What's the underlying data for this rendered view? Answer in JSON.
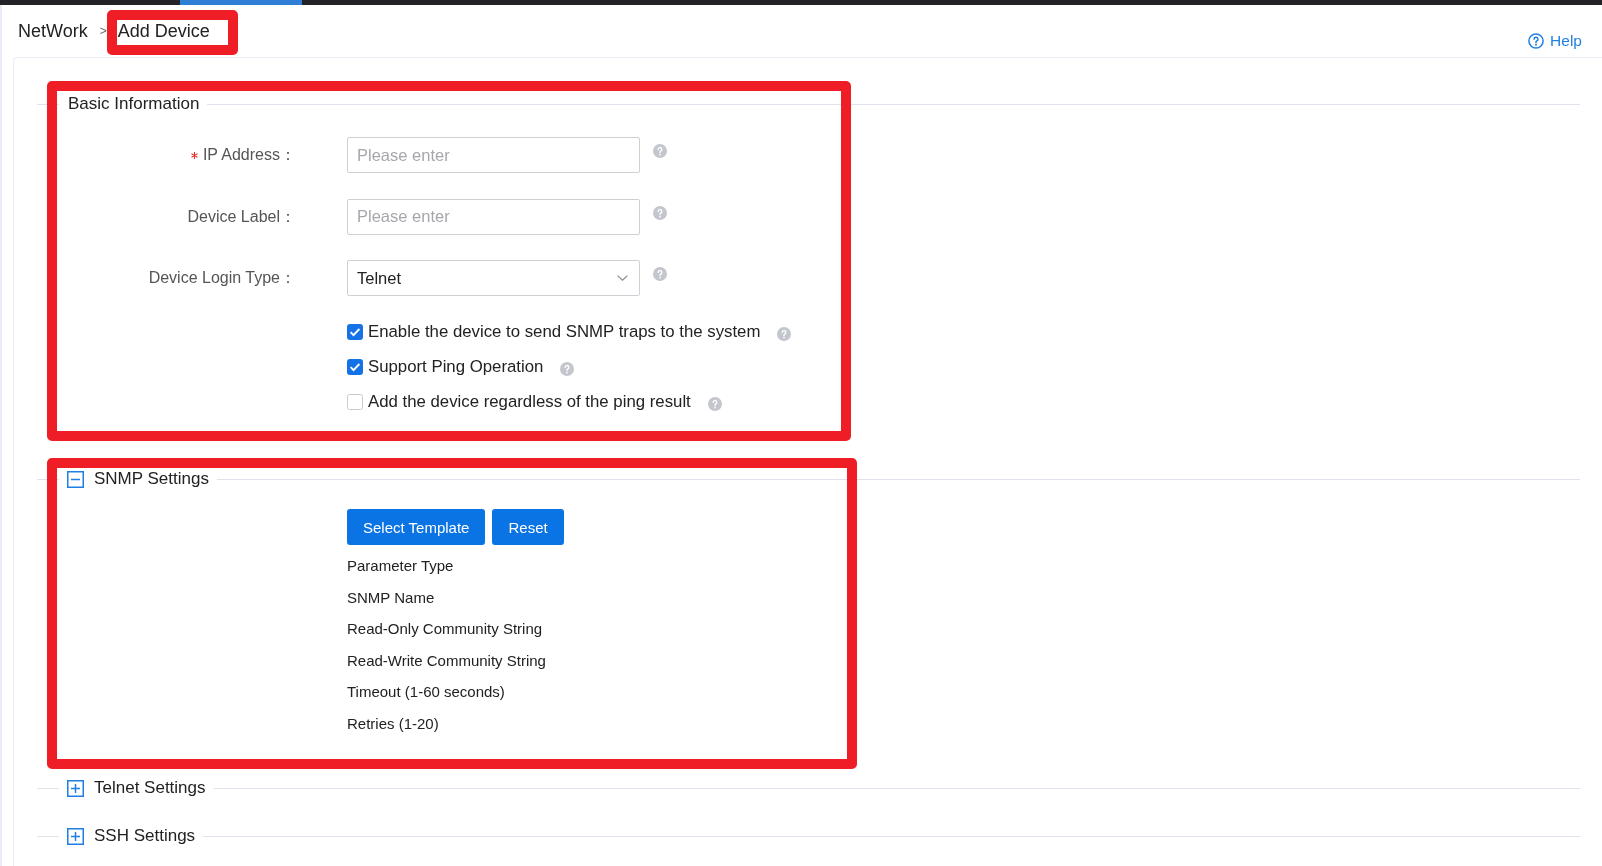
{
  "breadcrumb": {
    "separator": ">",
    "items": [
      {
        "label": "NetWork",
        "highlighted": false
      },
      {
        "label": "Add Device",
        "highlighted": true
      }
    ]
  },
  "help_link": {
    "label": "Help"
  },
  "sections": [
    {
      "kind": "fieldset",
      "title": "Basic Information",
      "highlighted": true,
      "fields": [
        {
          "kind": "text",
          "label": "IP Address：",
          "required": true,
          "placeholder": "Please enter"
        },
        {
          "kind": "text",
          "label": "Device Label：",
          "required": false,
          "placeholder": "Please enter"
        },
        {
          "kind": "select",
          "label": "Device Login Type：",
          "required": false,
          "value": "Telnet"
        }
      ],
      "checkboxes": [
        {
          "label": "Enable the device to send SNMP traps to the system",
          "checked": true
        },
        {
          "label": "Support Ping Operation",
          "checked": true
        },
        {
          "label": "Add the device regardless of the ping result",
          "checked": false
        }
      ]
    },
    {
      "kind": "collapsible",
      "title": "SNMP Settings",
      "expanded": true,
      "highlighted": true,
      "buttons": [
        {
          "label": "Select Template"
        },
        {
          "label": "Reset"
        }
      ],
      "parameters": [
        "Parameter Type",
        "SNMP Name",
        "Read-Only Community String",
        "Read-Write Community String",
        "Timeout (1-60 seconds)",
        "Retries (1-20)"
      ]
    },
    {
      "kind": "collapsible",
      "title": "Telnet Settings",
      "expanded": false,
      "highlighted": false
    },
    {
      "kind": "collapsible",
      "title": "SSH Settings",
      "expanded": false,
      "highlighted": false
    }
  ]
}
